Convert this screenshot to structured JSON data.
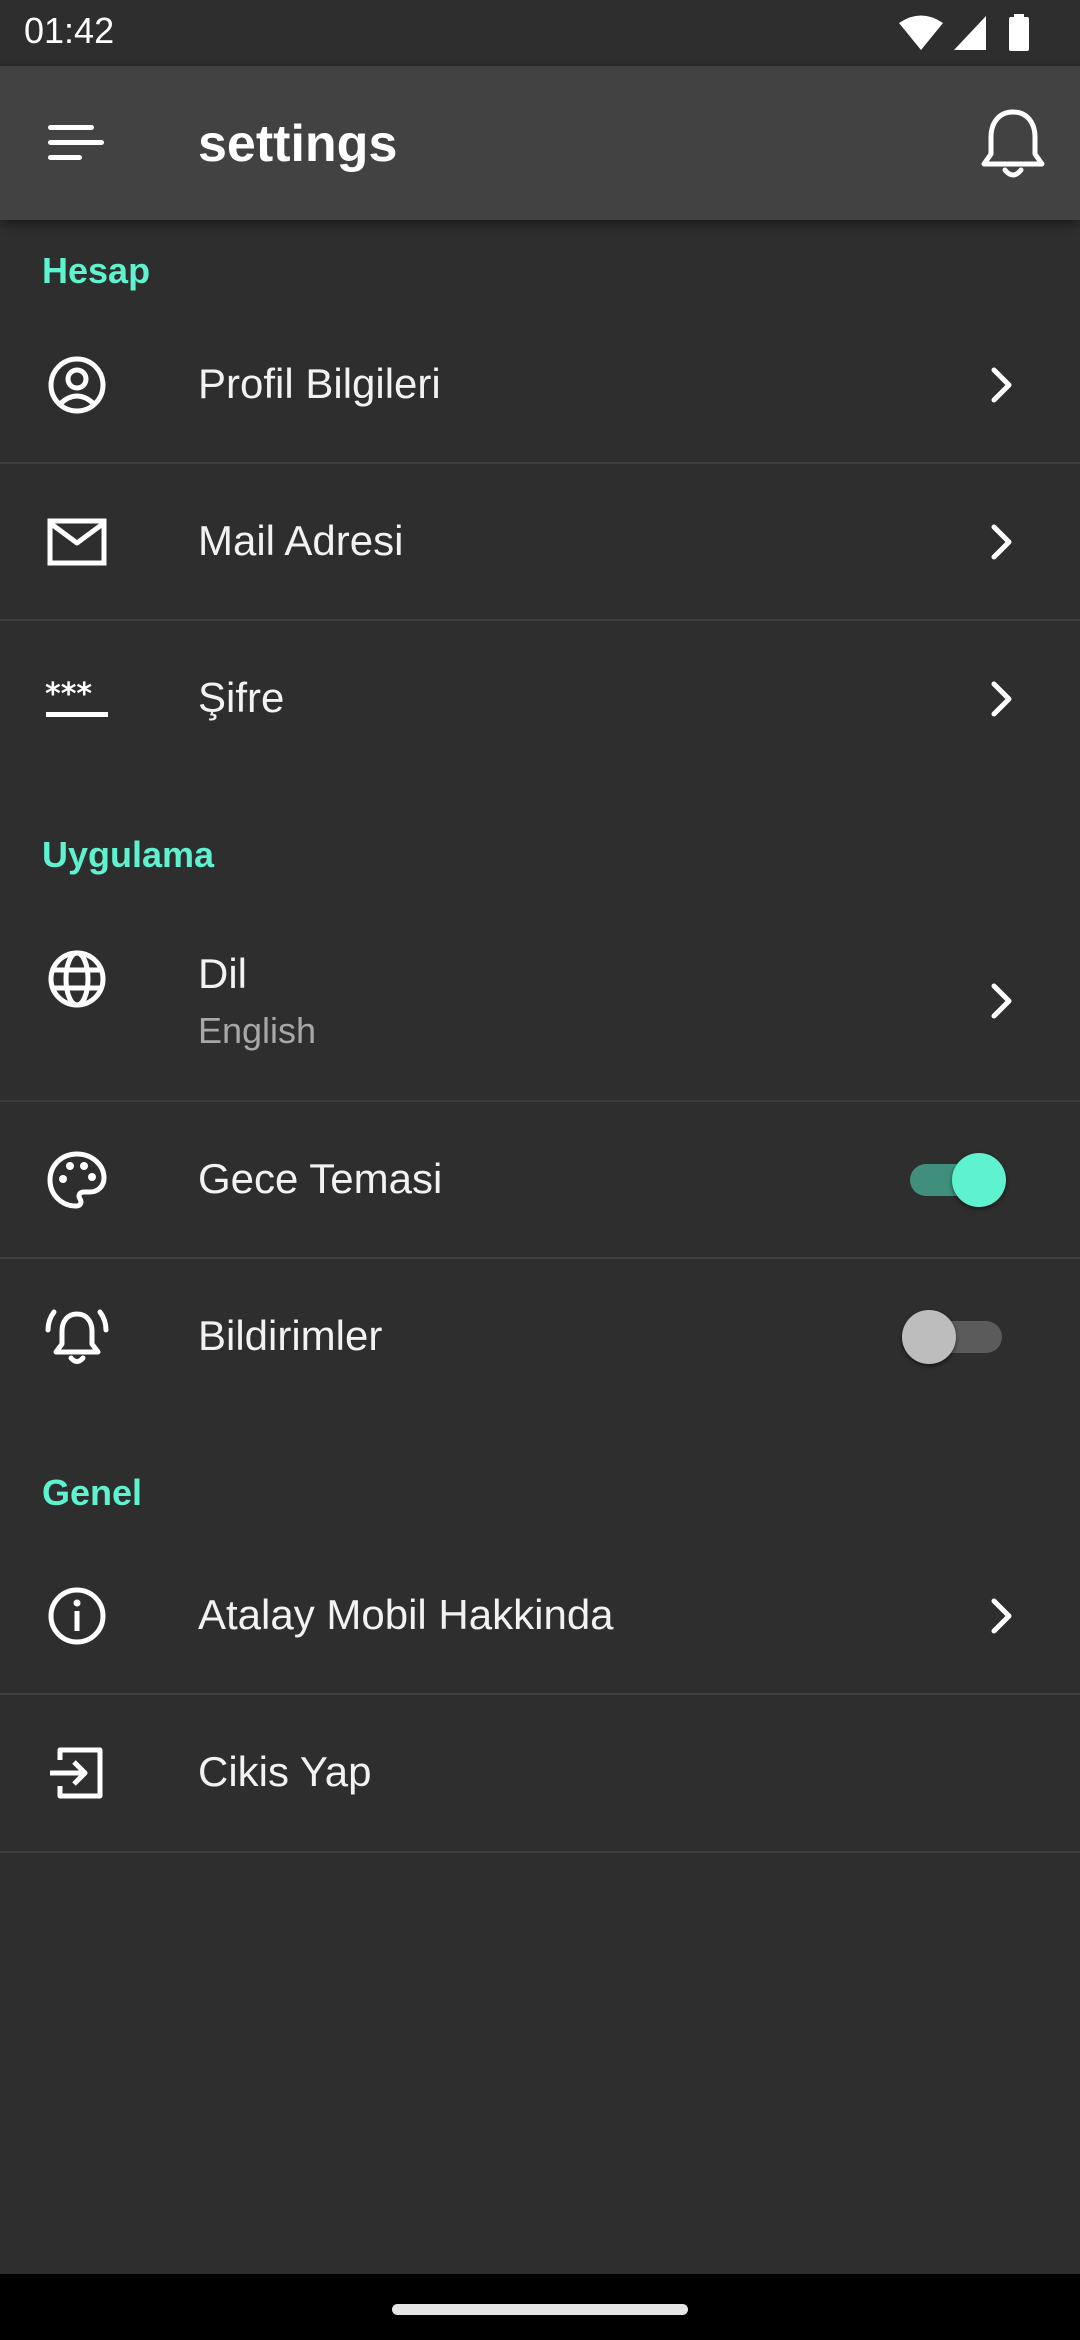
{
  "status_bar": {
    "time": "01:42"
  },
  "app_bar": {
    "title": "settings"
  },
  "sections": {
    "account": {
      "header": "Hesap",
      "items": [
        {
          "label": "Profil Bilgileri",
          "icon": "account-circle-icon"
        },
        {
          "label": "Mail Adresi",
          "icon": "mail-icon"
        },
        {
          "label": "Şifre",
          "icon": "password-icon"
        }
      ]
    },
    "app": {
      "header": "Uygulama",
      "language": {
        "label": "Dil",
        "value": "English",
        "icon": "globe-icon"
      },
      "night_theme": {
        "label": "Gece Temasi",
        "enabled": true,
        "icon": "palette-icon"
      },
      "notifications": {
        "label": "Bildirimler",
        "enabled": false,
        "icon": "alarm-bell-icon"
      }
    },
    "general": {
      "header": "Genel",
      "items": [
        {
          "label": "Atalay Mobil Hakkinda",
          "icon": "info-icon"
        },
        {
          "label": "Cikis Yap",
          "icon": "logout-icon"
        }
      ]
    }
  },
  "colors": {
    "background": "#2e2e2e",
    "app_bar": "#424242",
    "accent": "#5ef2cf",
    "divider": "#3f3f3f",
    "subtitle": "#a8a8a8"
  }
}
